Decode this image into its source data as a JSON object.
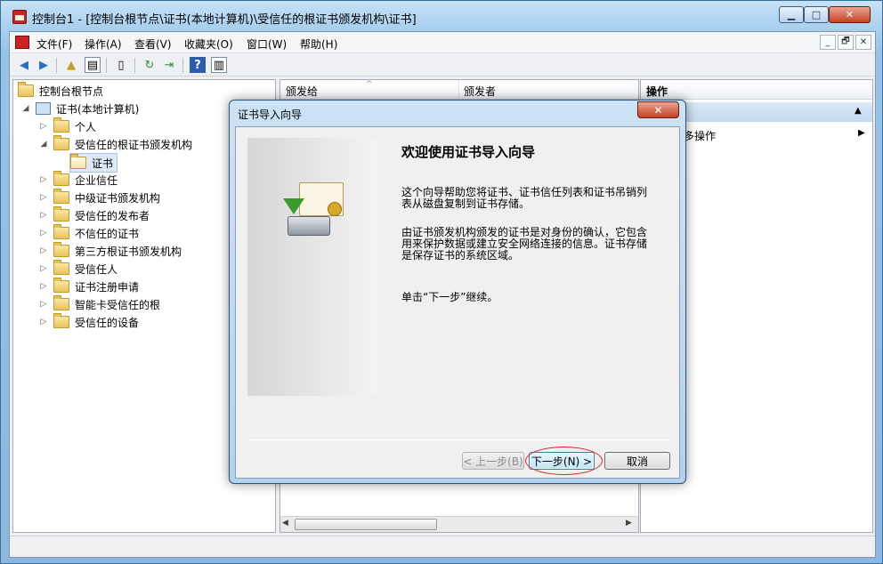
{
  "window": {
    "title": "控制台1 - [控制台根节点\\证书(本地计算机)\\受信任的根证书颁发机构\\证书]",
    "controls": {
      "minimize": "▁",
      "maximize": "□",
      "close": "✕"
    }
  },
  "menubar": {
    "items": [
      "文件(F)",
      "操作(A)",
      "查看(V)",
      "收藏夹(O)",
      "窗口(W)",
      "帮助(H)"
    ],
    "mdi_controls": {
      "minimize": "_",
      "restore": "🗗",
      "close": "✕"
    }
  },
  "toolbar": {
    "icons": [
      "back-arrow-icon",
      "forward-arrow-icon",
      "up-folder-icon",
      "show-hide-tree-icon",
      "properties-icon",
      "refresh-icon",
      "export-list-icon",
      "help-icon",
      "show-hide-action-pane-icon"
    ]
  },
  "tree": {
    "root": "控制台根节点",
    "computer": "证书(本地计算机)",
    "items": [
      {
        "label": "个人",
        "expanded": false
      },
      {
        "label": "受信任的根证书颁发机构",
        "expanded": true
      },
      {
        "label": "证书",
        "selected": true
      },
      {
        "label": "企业信任",
        "expanded": false
      },
      {
        "label": "中级证书颁发机构",
        "expanded": false
      },
      {
        "label": "受信任的发布者",
        "expanded": false
      },
      {
        "label": "不信任的证书",
        "expanded": false
      },
      {
        "label": "第三方根证书颁发机构",
        "expanded": false
      },
      {
        "label": "受信任人",
        "expanded": false
      },
      {
        "label": "证书注册申请",
        "expanded": false
      },
      {
        "label": "智能卡受信任的根",
        "expanded": false
      },
      {
        "label": "受信任的设备",
        "expanded": false
      }
    ]
  },
  "list": {
    "columns": [
      "颁发给",
      "颁发者"
    ],
    "sort_glyph": "^"
  },
  "actions": {
    "header": "操作",
    "more_actions": "多操作"
  },
  "dialog": {
    "title": "证书导入向导",
    "close": "✕",
    "heading": "欢迎使用证书导入向导",
    "para1": "这个向导帮助您将证书、证书信任列表和证书吊销列表从磁盘复制到证书存储。",
    "para2": "由证书颁发机构颁发的证书是对身份的确认，它包含用来保护数据或建立安全网络连接的信息。证书存储是保存证书的系统区域。",
    "para3": "单击“下一步”继续。",
    "buttons": {
      "back": "< 上一步(B)",
      "next": "下一步(N) >",
      "cancel": "取消"
    }
  },
  "colors": {
    "highlight_circle": "#e02020",
    "accent": "#3c7fb1"
  }
}
